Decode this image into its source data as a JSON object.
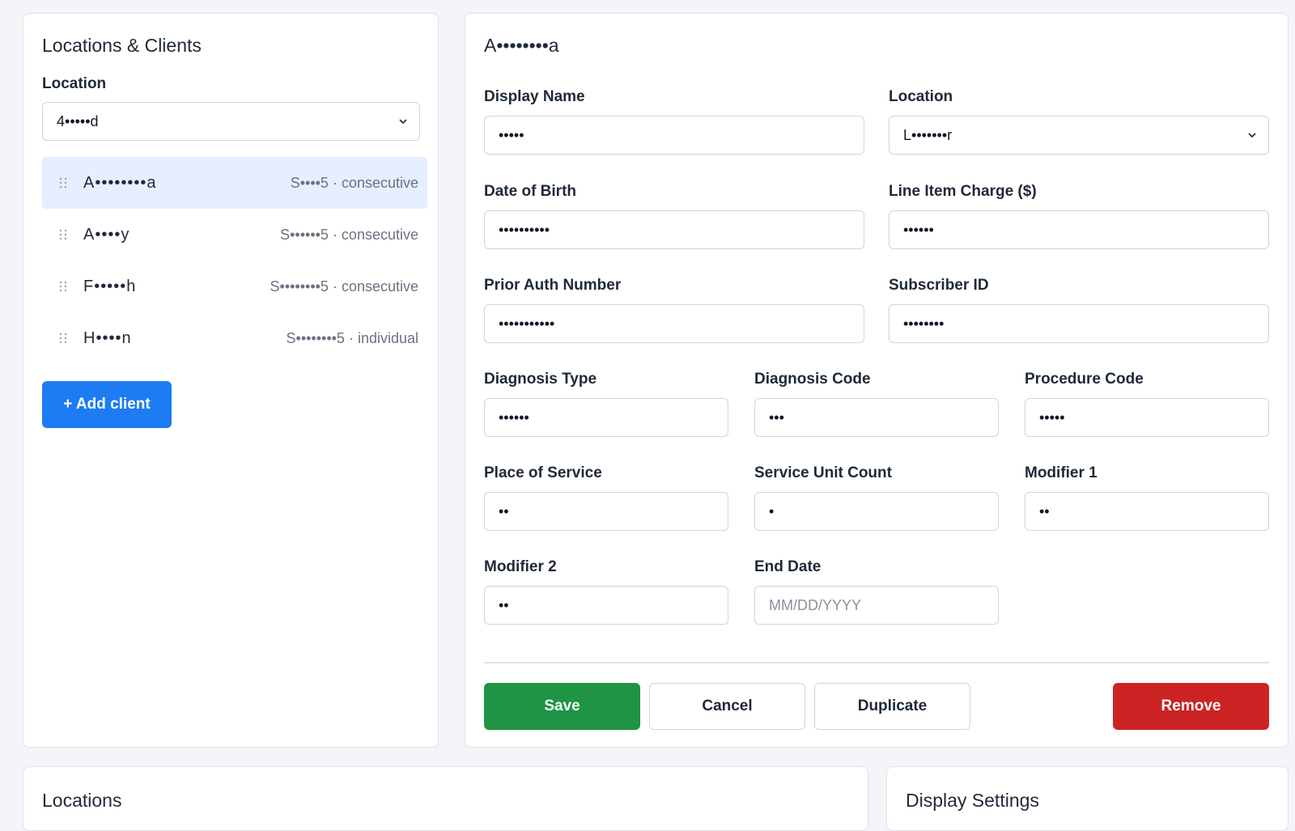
{
  "sidebar": {
    "title": "Locations & Clients",
    "location_label": "Location",
    "location_value": "4•••••d",
    "clients": [
      {
        "name": "A••••••••a",
        "meta": "S••••5 · consecutive",
        "active": true
      },
      {
        "name": "A••••y",
        "meta": "S••••••5 · consecutive",
        "active": false
      },
      {
        "name": "F•••••h",
        "meta": "S••••••••5 · consecutive",
        "active": false
      },
      {
        "name": "H••••n",
        "meta": "S••••••••5 · individual",
        "active": false
      }
    ],
    "add_client_label": "+ Add client"
  },
  "editor": {
    "title": "A••••••••a",
    "display_name": {
      "label": "Display Name",
      "value": "•••••"
    },
    "location": {
      "label": "Location",
      "value": "L•••••••r"
    },
    "date_of_birth": {
      "label": "Date of Birth",
      "value": "••••••••••"
    },
    "line_item_charge": {
      "label": "Line Item Charge ($)",
      "value": "••••••"
    },
    "prior_auth_number": {
      "label": "Prior Auth Number",
      "value": "•••••••••••"
    },
    "subscriber_id": {
      "label": "Subscriber ID",
      "value": "••••••••"
    },
    "diagnosis_type": {
      "label": "Diagnosis Type",
      "value": "••••••"
    },
    "diagnosis_code": {
      "label": "Diagnosis Code",
      "value": "•••"
    },
    "procedure_code": {
      "label": "Procedure Code",
      "value": "•••••"
    },
    "place_of_service": {
      "label": "Place of Service",
      "value": "••"
    },
    "service_unit_count": {
      "label": "Service Unit Count",
      "value": "•"
    },
    "modifier_1": {
      "label": "Modifier 1",
      "value": "••"
    },
    "modifier_2": {
      "label": "Modifier 2",
      "value": "••"
    },
    "end_date": {
      "label": "End Date",
      "placeholder": "MM/DD/YYYY"
    },
    "buttons": {
      "save": "Save",
      "cancel": "Cancel",
      "duplicate": "Duplicate",
      "remove": "Remove"
    }
  },
  "locations_panel": {
    "title": "Locations"
  },
  "display_settings_panel": {
    "title": "Display Settings"
  },
  "colors": {
    "primary": "#1d7cf2",
    "save": "#1e9444",
    "danger": "#cc2424",
    "active_row": "#e6efff"
  }
}
